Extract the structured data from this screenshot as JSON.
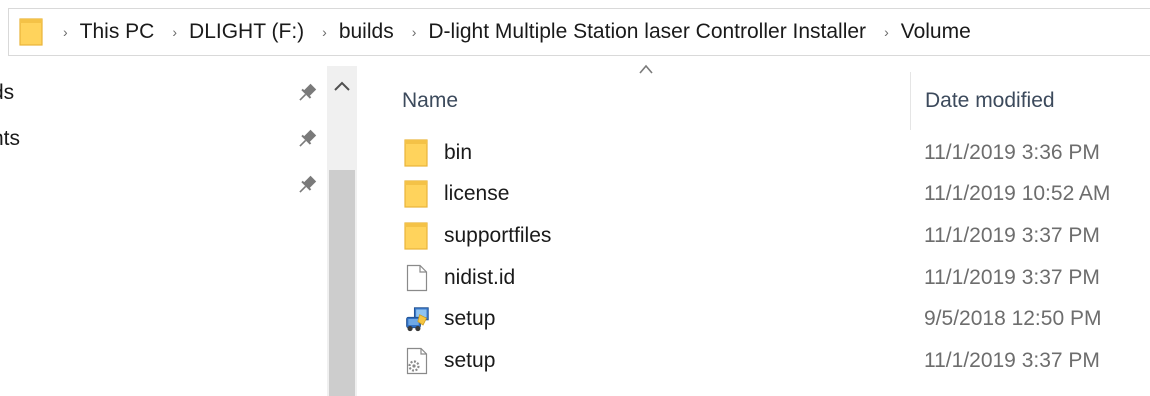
{
  "address_bar": {
    "folder_icon": "folder-icon",
    "separator_glyph": "›",
    "crumbs": [
      "This PC",
      "DLIGHT (F:)",
      "builds",
      "D-light Multiple Station laser Controller Installer",
      "Volume"
    ]
  },
  "nav_pane": {
    "items": [
      {
        "label": "ds",
        "icon": "pin-icon"
      },
      {
        "label": "nts",
        "icon": "pin-icon"
      },
      {
        "label": "",
        "icon": "pin-icon"
      }
    ],
    "scroll_up_icon": "chevron-up-icon"
  },
  "file_list": {
    "columns": {
      "name": "Name",
      "date_modified": "Date modified"
    },
    "sort_indicator": "sort-ascending-icon",
    "files": [
      {
        "name": "bin",
        "date": "11/1/2019 3:36 PM",
        "icon": "folder-icon"
      },
      {
        "name": "license",
        "date": "11/1/2019 10:52 AM",
        "icon": "folder-icon"
      },
      {
        "name": "supportfiles",
        "date": "11/1/2019 3:37 PM",
        "icon": "folder-icon"
      },
      {
        "name": "nidist.id",
        "date": "11/1/2019 3:37 PM",
        "icon": "file-icon"
      },
      {
        "name": "setup",
        "date": "9/5/2018 12:50 PM",
        "icon": "installer-icon"
      },
      {
        "name": "setup",
        "date": "11/1/2019 3:37 PM",
        "icon": "settings-file-icon"
      }
    ]
  },
  "colors": {
    "folder": "#ffd35c",
    "folder_dark": "#e8b43a",
    "header_text": "#3c4a5c",
    "date_text": "#6d6d6d",
    "scrollbar_track": "#f0f0f0",
    "scrollbar_thumb": "#cdcdcd"
  }
}
